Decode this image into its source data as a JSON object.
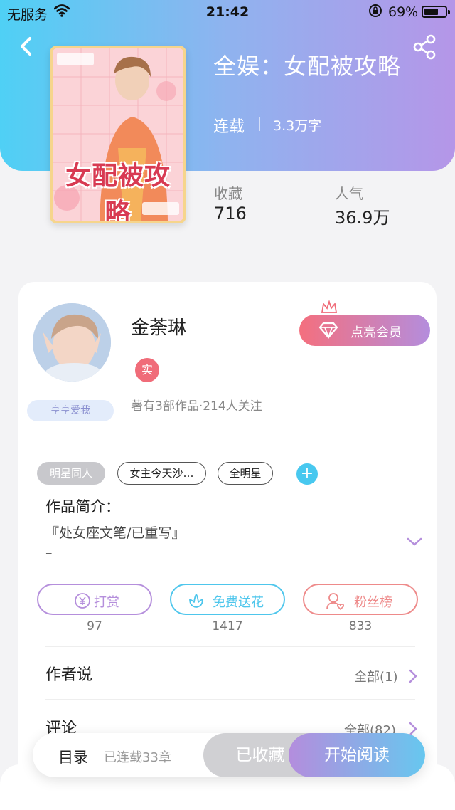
{
  "status_bar": {
    "carrier": "无服务",
    "time": "21:42",
    "battery_pct": "69%",
    "battery_level": 0.69
  },
  "book": {
    "title": "全娱：女配被攻略",
    "status": "连载",
    "word_count": "3.3万字",
    "cover_text": "女配被攻略",
    "stats": {
      "favorites_label": "收藏",
      "favorites_value": "716",
      "popularity_label": "人气",
      "popularity_value": "36.9万"
    }
  },
  "author": {
    "name": "金荼琳",
    "real_badge": "实",
    "meta": "著有3部作品·214人关注",
    "badge_text": "亨亨爱我",
    "vip_button": "点亮会员"
  },
  "tags": [
    {
      "label": "明星同人",
      "style": "filled"
    },
    {
      "label": "女主今天沙…",
      "style": "outlined"
    },
    {
      "label": "全明星",
      "style": "outlined"
    }
  ],
  "intro": {
    "title": "作品简介：",
    "line1": "『处女座文笔/已重写』",
    "line2": "–"
  },
  "actions": [
    {
      "label": "打赏",
      "count": "97",
      "color": "#b58fdc",
      "icon": "yen-icon"
    },
    {
      "label": "免费送花",
      "count": "1417",
      "color": "#4ec6ec",
      "icon": "flower-icon"
    },
    {
      "label": "粉丝榜",
      "count": "833",
      "color": "#ee8a8a",
      "icon": "fans-icon"
    }
  ],
  "sections": {
    "author_says": {
      "title": "作者说",
      "link": "全部(1)"
    },
    "comments": {
      "title": "评论",
      "link": "全部(82)"
    }
  },
  "bottom_bar": {
    "toc": "目录",
    "chapters": "已连载33章",
    "collected": "已收藏",
    "start_read": "开始阅读"
  },
  "colors": {
    "header_gradient_start": "#4fd0f5",
    "header_gradient_end": "#b596e8",
    "accent_purple": "#b48ddd",
    "accent_blue": "#48c8ef",
    "accent_pink": "#f06c79"
  }
}
